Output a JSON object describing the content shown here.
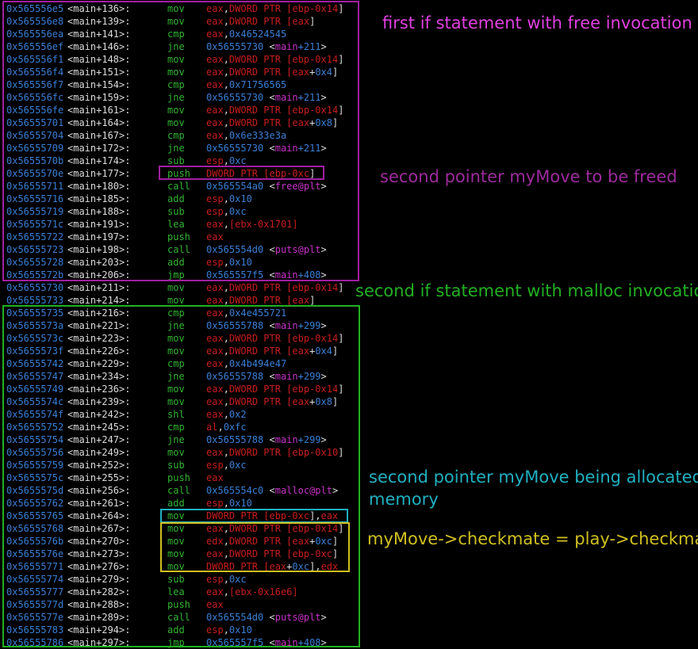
{
  "colors": {
    "background": "#000000",
    "address": "#3a7fd6",
    "mnemonic": "#32b432",
    "register": "#c81e1e",
    "symbol": "#c832c8",
    "purple_box": "#a020a0",
    "purple_text_bright": "#e040e0",
    "purple_text_dim": "#9c2a9c",
    "green": "#22b022",
    "cyan": "#20b0c0",
    "yellow": "#d0c020"
  },
  "annotations": {
    "free_if": "first if statement with free invocation",
    "freed_pointer": "second pointer myMove to be freed",
    "malloc_if": "second if statement with malloc invocation",
    "alloc_pointer_line1": "second pointer myMove being allocated",
    "alloc_pointer_line2": "memory",
    "checkmate_assign": "myMove->checkmate = play->checkmate"
  },
  "lines": [
    {
      "addr": "0x565556e5",
      "off": "<main+136>:",
      "mn": "mov",
      "ops": [
        [
          "eax",
          "r"
        ],
        [
          ",",
          "p"
        ],
        [
          "DWORD PTR [",
          "r"
        ],
        [
          "ebp-0x14",
          "r"
        ],
        [
          "]",
          "p"
        ]
      ]
    },
    {
      "addr": "0x565556e8",
      "off": "<main+139>:",
      "mn": "mov",
      "ops": [
        [
          "eax",
          "r"
        ],
        [
          ",",
          "p"
        ],
        [
          "DWORD PTR [",
          "r"
        ],
        [
          "eax",
          "r"
        ],
        [
          "]",
          "p"
        ]
      ]
    },
    {
      "addr": "0x565556ea",
      "off": "<main+141>:",
      "mn": "cmp",
      "ops": [
        [
          "eax",
          "r"
        ],
        [
          ",",
          "p"
        ],
        [
          "0x46524545",
          "n"
        ]
      ]
    },
    {
      "addr": "0x565556ef",
      "off": "<main+146>:",
      "mn": "jne",
      "ops": [
        [
          "0x56555730 ",
          "n"
        ],
        [
          "<",
          "p"
        ],
        [
          "main",
          "s"
        ],
        [
          "+211",
          "n"
        ],
        [
          ">",
          "p"
        ]
      ]
    },
    {
      "addr": "0x565556f1",
      "off": "<main+148>:",
      "mn": "mov",
      "ops": [
        [
          "eax",
          "r"
        ],
        [
          ",",
          "p"
        ],
        [
          "DWORD PTR [",
          "r"
        ],
        [
          "ebp-0x14",
          "r"
        ],
        [
          "]",
          "p"
        ]
      ]
    },
    {
      "addr": "0x565556f4",
      "off": "<main+151>:",
      "mn": "mov",
      "ops": [
        [
          "eax",
          "r"
        ],
        [
          ",",
          "p"
        ],
        [
          "DWORD PTR [",
          "r"
        ],
        [
          "eax",
          "r"
        ],
        [
          "+",
          "p"
        ],
        [
          "0x4",
          "n"
        ],
        [
          "]",
          "p"
        ]
      ]
    },
    {
      "addr": "0x565556f7",
      "off": "<main+154>:",
      "mn": "cmp",
      "ops": [
        [
          "eax",
          "r"
        ],
        [
          ",",
          "p"
        ],
        [
          "0x71756565",
          "n"
        ]
      ]
    },
    {
      "addr": "0x565556fc",
      "off": "<main+159>:",
      "mn": "jne",
      "ops": [
        [
          "0x56555730 ",
          "n"
        ],
        [
          "<",
          "p"
        ],
        [
          "main",
          "s"
        ],
        [
          "+211",
          "n"
        ],
        [
          ">",
          "p"
        ]
      ]
    },
    {
      "addr": "0x565556fe",
      "off": "<main+161>:",
      "mn": "mov",
      "ops": [
        [
          "eax",
          "r"
        ],
        [
          ",",
          "p"
        ],
        [
          "DWORD PTR [",
          "r"
        ],
        [
          "ebp-0x14",
          "r"
        ],
        [
          "]",
          "p"
        ]
      ]
    },
    {
      "addr": "0x56555701",
      "off": "<main+164>:",
      "mn": "mov",
      "ops": [
        [
          "eax",
          "r"
        ],
        [
          ",",
          "p"
        ],
        [
          "DWORD PTR [",
          "r"
        ],
        [
          "eax",
          "r"
        ],
        [
          "+",
          "p"
        ],
        [
          "0x8",
          "n"
        ],
        [
          "]",
          "p"
        ]
      ]
    },
    {
      "addr": "0x56555704",
      "off": "<main+167>:",
      "mn": "cmp",
      "ops": [
        [
          "eax",
          "r"
        ],
        [
          ",",
          "p"
        ],
        [
          "0x6e333e3a",
          "n"
        ]
      ]
    },
    {
      "addr": "0x56555709",
      "off": "<main+172>:",
      "mn": "jne",
      "ops": [
        [
          "0x56555730 ",
          "n"
        ],
        [
          "<",
          "p"
        ],
        [
          "main",
          "s"
        ],
        [
          "+211",
          "n"
        ],
        [
          ">",
          "p"
        ]
      ]
    },
    {
      "addr": "0x5655570b",
      "off": "<main+174>:",
      "mn": "sub",
      "ops": [
        [
          "esp",
          "r"
        ],
        [
          ",",
          "p"
        ],
        [
          "0xc",
          "n"
        ]
      ]
    },
    {
      "addr": "0x5655570e",
      "off": "<main+177>:",
      "mn": "push",
      "ops": [
        [
          "DWORD PTR [",
          "r"
        ],
        [
          "ebp-0xc",
          "r"
        ],
        [
          "]",
          "p"
        ]
      ]
    },
    {
      "addr": "0x56555711",
      "off": "<main+180>:",
      "mn": "call",
      "ops": [
        [
          "0x565554a0 ",
          "n"
        ],
        [
          "<",
          "p"
        ],
        [
          "free@plt",
          "s"
        ],
        [
          ">",
          "p"
        ]
      ]
    },
    {
      "addr": "0x56555716",
      "off": "<main+185>:",
      "mn": "add",
      "ops": [
        [
          "esp",
          "r"
        ],
        [
          ",",
          "p"
        ],
        [
          "0x10",
          "n"
        ]
      ]
    },
    {
      "addr": "0x56555719",
      "off": "<main+188>:",
      "mn": "sub",
      "ops": [
        [
          "esp",
          "r"
        ],
        [
          ",",
          "p"
        ],
        [
          "0xc",
          "n"
        ]
      ]
    },
    {
      "addr": "0x5655571c",
      "off": "<main+191>:",
      "mn": "lea",
      "ops": [
        [
          "eax",
          "r"
        ],
        [
          ",",
          "p"
        ],
        [
          "[ebx-0x1701]",
          "r"
        ]
      ]
    },
    {
      "addr": "0x56555722",
      "off": "<main+197>:",
      "mn": "push",
      "ops": [
        [
          "eax",
          "r"
        ]
      ]
    },
    {
      "addr": "0x56555723",
      "off": "<main+198>:",
      "mn": "call",
      "ops": [
        [
          "0x565554d0 ",
          "n"
        ],
        [
          "<",
          "p"
        ],
        [
          "puts@plt",
          "s"
        ],
        [
          ">",
          "p"
        ]
      ]
    },
    {
      "addr": "0x56555728",
      "off": "<main+203>:",
      "mn": "add",
      "ops": [
        [
          "esp",
          "r"
        ],
        [
          ",",
          "p"
        ],
        [
          "0x10",
          "n"
        ]
      ]
    },
    {
      "addr": "0x5655572b",
      "off": "<main+206>:",
      "mn": "jmp",
      "ops": [
        [
          "0x565557f5 ",
          "n"
        ],
        [
          "<",
          "p"
        ],
        [
          "main",
          "s"
        ],
        [
          "+408",
          "n"
        ],
        [
          ">",
          "p"
        ]
      ]
    },
    {
      "addr": "0x56555730",
      "off": "<main+211>:",
      "mn": "mov",
      "ops": [
        [
          "eax",
          "r"
        ],
        [
          ",",
          "p"
        ],
        [
          "DWORD PTR [",
          "r"
        ],
        [
          "ebp-0x14",
          "r"
        ],
        [
          "]",
          "p"
        ]
      ]
    },
    {
      "addr": "0x56555733",
      "off": "<main+214>:",
      "mn": "mov",
      "ops": [
        [
          "eax",
          "r"
        ],
        [
          ",",
          "p"
        ],
        [
          "DWORD PTR [",
          "r"
        ],
        [
          "eax",
          "r"
        ],
        [
          "]",
          "p"
        ]
      ]
    },
    {
      "addr": "0x56555735",
      "off": "<main+216>:",
      "mn": "cmp",
      "ops": [
        [
          "eax",
          "r"
        ],
        [
          ",",
          "p"
        ],
        [
          "0x4e455721",
          "n"
        ]
      ]
    },
    {
      "addr": "0x5655573a",
      "off": "<main+221>:",
      "mn": "jne",
      "ops": [
        [
          "0x56555788 ",
          "n"
        ],
        [
          "<",
          "p"
        ],
        [
          "main",
          "s"
        ],
        [
          "+299",
          "n"
        ],
        [
          ">",
          "p"
        ]
      ]
    },
    {
      "addr": "0x5655573c",
      "off": "<main+223>:",
      "mn": "mov",
      "ops": [
        [
          "eax",
          "r"
        ],
        [
          ",",
          "p"
        ],
        [
          "DWORD PTR [",
          "r"
        ],
        [
          "ebp-0x14",
          "r"
        ],
        [
          "]",
          "p"
        ]
      ]
    },
    {
      "addr": "0x5655573f",
      "off": "<main+226>:",
      "mn": "mov",
      "ops": [
        [
          "eax",
          "r"
        ],
        [
          ",",
          "p"
        ],
        [
          "DWORD PTR [",
          "r"
        ],
        [
          "eax",
          "r"
        ],
        [
          "+",
          "p"
        ],
        [
          "0x4",
          "n"
        ],
        [
          "]",
          "p"
        ]
      ]
    },
    {
      "addr": "0x56555742",
      "off": "<main+229>:",
      "mn": "cmp",
      "ops": [
        [
          "eax",
          "r"
        ],
        [
          ",",
          "p"
        ],
        [
          "0x4b494e47",
          "n"
        ]
      ]
    },
    {
      "addr": "0x56555747",
      "off": "<main+234>:",
      "mn": "jne",
      "ops": [
        [
          "0x56555788 ",
          "n"
        ],
        [
          "<",
          "p"
        ],
        [
          "main",
          "s"
        ],
        [
          "+299",
          "n"
        ],
        [
          ">",
          "p"
        ]
      ]
    },
    {
      "addr": "0x56555749",
      "off": "<main+236>:",
      "mn": "mov",
      "ops": [
        [
          "eax",
          "r"
        ],
        [
          ",",
          "p"
        ],
        [
          "DWORD PTR [",
          "r"
        ],
        [
          "ebp-0x14",
          "r"
        ],
        [
          "]",
          "p"
        ]
      ]
    },
    {
      "addr": "0x5655574c",
      "off": "<main+239>:",
      "mn": "mov",
      "ops": [
        [
          "eax",
          "r"
        ],
        [
          ",",
          "p"
        ],
        [
          "DWORD PTR [",
          "r"
        ],
        [
          "eax",
          "r"
        ],
        [
          "+",
          "p"
        ],
        [
          "0x8",
          "n"
        ],
        [
          "]",
          "p"
        ]
      ]
    },
    {
      "addr": "0x5655574f",
      "off": "<main+242>:",
      "mn": "shl",
      "ops": [
        [
          "eax",
          "r"
        ],
        [
          ",",
          "p"
        ],
        [
          "0x2",
          "n"
        ]
      ]
    },
    {
      "addr": "0x56555752",
      "off": "<main+245>:",
      "mn": "cmp",
      "ops": [
        [
          "al",
          "r"
        ],
        [
          ",",
          "p"
        ],
        [
          "0xfc",
          "n"
        ]
      ]
    },
    {
      "addr": "0x56555754",
      "off": "<main+247>:",
      "mn": "jne",
      "ops": [
        [
          "0x56555788 ",
          "n"
        ],
        [
          "<",
          "p"
        ],
        [
          "main",
          "s"
        ],
        [
          "+299",
          "n"
        ],
        [
          ">",
          "p"
        ]
      ]
    },
    {
      "addr": "0x56555756",
      "off": "<main+249>:",
      "mn": "mov",
      "ops": [
        [
          "eax",
          "r"
        ],
        [
          ",",
          "p"
        ],
        [
          "DWORD PTR [",
          "r"
        ],
        [
          "ebp-0x10",
          "r"
        ],
        [
          "]",
          "p"
        ]
      ]
    },
    {
      "addr": "0x56555759",
      "off": "<main+252>:",
      "mn": "sub",
      "ops": [
        [
          "esp",
          "r"
        ],
        [
          ",",
          "p"
        ],
        [
          "0xc",
          "n"
        ]
      ]
    },
    {
      "addr": "0x5655575c",
      "off": "<main+255>:",
      "mn": "push",
      "ops": [
        [
          "eax",
          "r"
        ]
      ]
    },
    {
      "addr": "0x5655575d",
      "off": "<main+256>:",
      "mn": "call",
      "ops": [
        [
          "0x565554c0 ",
          "n"
        ],
        [
          "<",
          "p"
        ],
        [
          "malloc@plt",
          "s"
        ],
        [
          ">",
          "p"
        ]
      ]
    },
    {
      "addr": "0x56555762",
      "off": "<main+261>:",
      "mn": "add",
      "ops": [
        [
          "esp",
          "r"
        ],
        [
          ",",
          "p"
        ],
        [
          "0x10",
          "n"
        ]
      ]
    },
    {
      "addr": "0x56555765",
      "off": "<main+264>:",
      "mn": "mov",
      "ops": [
        [
          "DWORD PTR [",
          "r"
        ],
        [
          "ebp-0xc",
          "r"
        ],
        [
          "]",
          "p"
        ],
        [
          ",",
          "p"
        ],
        [
          "eax",
          "r"
        ]
      ]
    },
    {
      "addr": "0x56555768",
      "off": "<main+267>:",
      "mn": "mov",
      "ops": [
        [
          "eax",
          "r"
        ],
        [
          ",",
          "p"
        ],
        [
          "DWORD PTR [",
          "r"
        ],
        [
          "ebp-0x14",
          "r"
        ],
        [
          "]",
          "p"
        ]
      ]
    },
    {
      "addr": "0x5655576b",
      "off": "<main+270>:",
      "mn": "mov",
      "ops": [
        [
          "edx",
          "r"
        ],
        [
          ",",
          "p"
        ],
        [
          "DWORD PTR [",
          "r"
        ],
        [
          "eax",
          "r"
        ],
        [
          "+",
          "p"
        ],
        [
          "0xc",
          "n"
        ],
        [
          "]",
          "p"
        ]
      ]
    },
    {
      "addr": "0x5655576e",
      "off": "<main+273>:",
      "mn": "mov",
      "ops": [
        [
          "eax",
          "r"
        ],
        [
          ",",
          "p"
        ],
        [
          "DWORD PTR [",
          "r"
        ],
        [
          "ebp-0xc",
          "r"
        ],
        [
          "]",
          "p"
        ]
      ]
    },
    {
      "addr": "0x56555771",
      "off": "<main+276>:",
      "mn": "mov",
      "ops": [
        [
          "DWORD PTR [",
          "r"
        ],
        [
          "eax",
          "r"
        ],
        [
          "+",
          "p"
        ],
        [
          "0xc",
          "n"
        ],
        [
          "]",
          "p"
        ],
        [
          ",",
          "p"
        ],
        [
          "edx",
          "r"
        ]
      ]
    },
    {
      "addr": "0x56555774",
      "off": "<main+279>:",
      "mn": "sub",
      "ops": [
        [
          "esp",
          "r"
        ],
        [
          ",",
          "p"
        ],
        [
          "0xc",
          "n"
        ]
      ]
    },
    {
      "addr": "0x56555777",
      "off": "<main+282>:",
      "mn": "lea",
      "ops": [
        [
          "eax",
          "r"
        ],
        [
          ",",
          "p"
        ],
        [
          "[ebx-0x16e6]",
          "r"
        ]
      ]
    },
    {
      "addr": "0x5655577d",
      "off": "<main+288>:",
      "mn": "push",
      "ops": [
        [
          "eax",
          "r"
        ]
      ]
    },
    {
      "addr": "0x5655577e",
      "off": "<main+289>:",
      "mn": "call",
      "ops": [
        [
          "0x565554d0 ",
          "n"
        ],
        [
          "<",
          "p"
        ],
        [
          "puts@plt",
          "s"
        ],
        [
          ">",
          "p"
        ]
      ]
    },
    {
      "addr": "0x56555783",
      "off": "<main+294>:",
      "mn": "add",
      "ops": [
        [
          "esp",
          "r"
        ],
        [
          ",",
          "p"
        ],
        [
          "0x10",
          "n"
        ]
      ]
    },
    {
      "addr": "0x56555786",
      "off": "<main+297>:",
      "mn": "jmp",
      "ops": [
        [
          "0x565557f5 ",
          "n"
        ],
        [
          "<",
          "p"
        ],
        [
          "main",
          "s"
        ],
        [
          "+408",
          "n"
        ],
        [
          ">",
          "p"
        ]
      ]
    }
  ]
}
